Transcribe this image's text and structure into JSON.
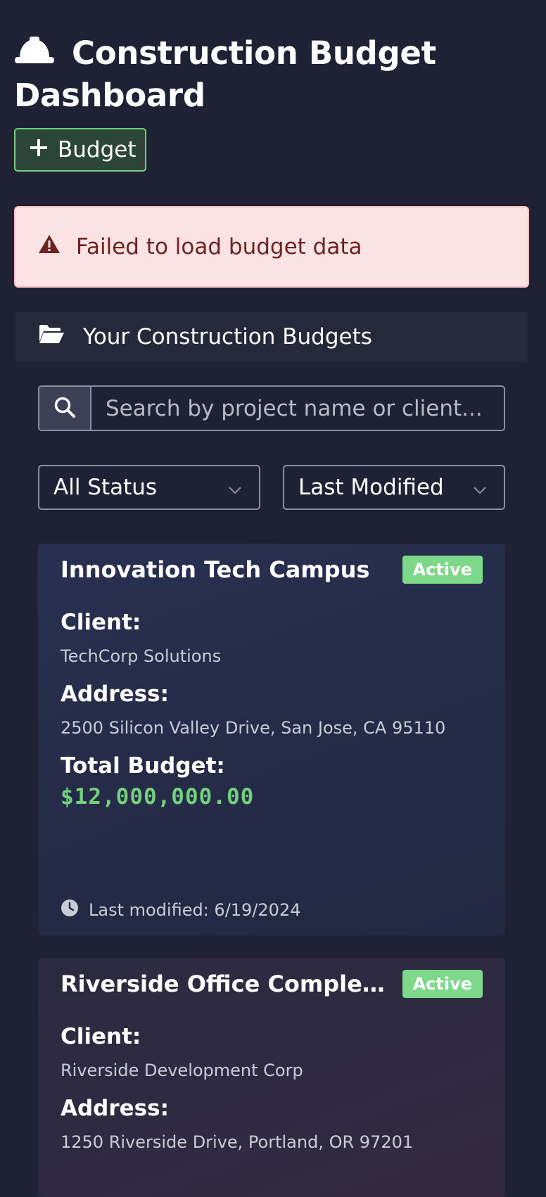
{
  "header": {
    "title": "Construction Budget Dashboard",
    "title_icon": "hard-hat-icon",
    "add_button_label": "Budget",
    "add_icon": "plus-icon"
  },
  "alert": {
    "icon": "warning-icon",
    "message": "Failed to load budget data",
    "color": "#6e2222"
  },
  "section": {
    "icon": "folder-open-icon",
    "title": "Your Construction Budgets"
  },
  "search": {
    "icon": "search-icon",
    "placeholder": "Search by project name or client...",
    "value": ""
  },
  "filters": {
    "status_selected": "All Status",
    "sort_selected": "Last Modified"
  },
  "labels": {
    "client": "Client:",
    "address": "Address:",
    "total_budget": "Total Budget:",
    "last_modified_prefix": "Last modified:"
  },
  "colors": {
    "accent_green": "#74d07f",
    "background": "#1e2234",
    "alert_bg": "#fbe3e3"
  },
  "budgets": [
    {
      "title": "Innovation Tech Campus",
      "status": "Active",
      "client": "TechCorp Solutions",
      "address": "2500 Silicon Valley Drive, San Jose, CA 95110",
      "total_budget": "$12,000,000.00",
      "last_modified": "Last modified: 6/19/2024"
    },
    {
      "title": "Riverside Office Complex - Ph...",
      "status": "Active",
      "client": "Riverside Development Corp",
      "address": "1250 Riverside Drive, Portland, OR 97201"
    }
  ]
}
